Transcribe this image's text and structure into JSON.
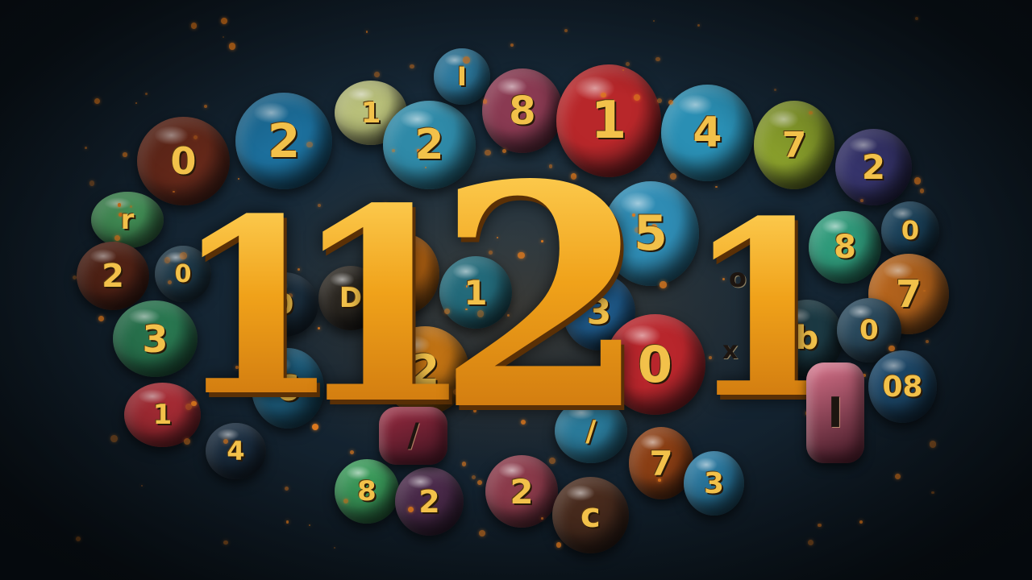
{
  "headline_digits": [
    "1",
    "1",
    "2",
    "1"
  ],
  "colors": {
    "gold": "#f3a51c",
    "background": "#13222f"
  },
  "balls": [
    {
      "label": "0",
      "color": "#6e2c1c"
    },
    {
      "label": "2",
      "color": "#1c6f9c"
    },
    {
      "label": "1",
      "color": "#b9c07a"
    },
    {
      "label": "2",
      "color": "#2f8aa8"
    },
    {
      "label": "I",
      "color": "#2e7fa6"
    },
    {
      "label": "8",
      "color": "#8a3a52"
    },
    {
      "label": "1",
      "color": "#b8272a"
    },
    {
      "label": "4",
      "color": "#2a8fb4"
    },
    {
      "label": "7",
      "color": "#8aa02c"
    },
    {
      "label": "2",
      "color": "#3c3a78"
    },
    {
      "label": "r",
      "color": "#4aa060"
    },
    {
      "label": "2",
      "color": "#5a2618"
    },
    {
      "label": "0",
      "color": "#1f3a4a"
    },
    {
      "label": "3",
      "color": "#2a7a52"
    },
    {
      "label": "D",
      "color": "#2a2620"
    },
    {
      "label": "1",
      "color": "#c06a14"
    },
    {
      "label": "1",
      "color": "#236a7a"
    },
    {
      "label": "5",
      "color": "#2f8cb4"
    },
    {
      "label": "0",
      "color": "#1c3040"
    },
    {
      "label": "8",
      "color": "#2f9a7a"
    },
    {
      "label": "0",
      "color": "#1e4a66"
    },
    {
      "label": "7",
      "color": "#c06a1e"
    },
    {
      "label": "3",
      "color": "#1f5a8a"
    },
    {
      "label": "0",
      "color": "#b8262c"
    },
    {
      "label": "2",
      "color": "#c07214"
    },
    {
      "label": "6",
      "color": "#1d5e7e"
    },
    {
      "label": "b",
      "color": "#1c3a44"
    },
    {
      "label": "0",
      "color": "#2a4a5e"
    },
    {
      "label": "08",
      "color": "#1f4f74"
    },
    {
      "label": "1",
      "color": "#b8303a"
    },
    {
      "label": "4",
      "color": "#1c3044"
    },
    {
      "label": "8",
      "color": "#3a9a5a"
    },
    {
      "label": "2",
      "color": "#4a2a4a"
    },
    {
      "label": "2",
      "color": "#8a3a4a"
    },
    {
      "label": "c",
      "color": "#4a2c1e"
    },
    {
      "label": "7",
      "color": "#8a3e14"
    },
    {
      "label": "3",
      "color": "#2a7aa2"
    },
    {
      "label": "/",
      "color": "#2a7a9a"
    }
  ],
  "pills": [
    {
      "label": "I",
      "color": "#d8728a"
    },
    {
      "label": "/",
      "color": "#9a2a40"
    }
  ],
  "letters": [
    "o",
    "x"
  ]
}
